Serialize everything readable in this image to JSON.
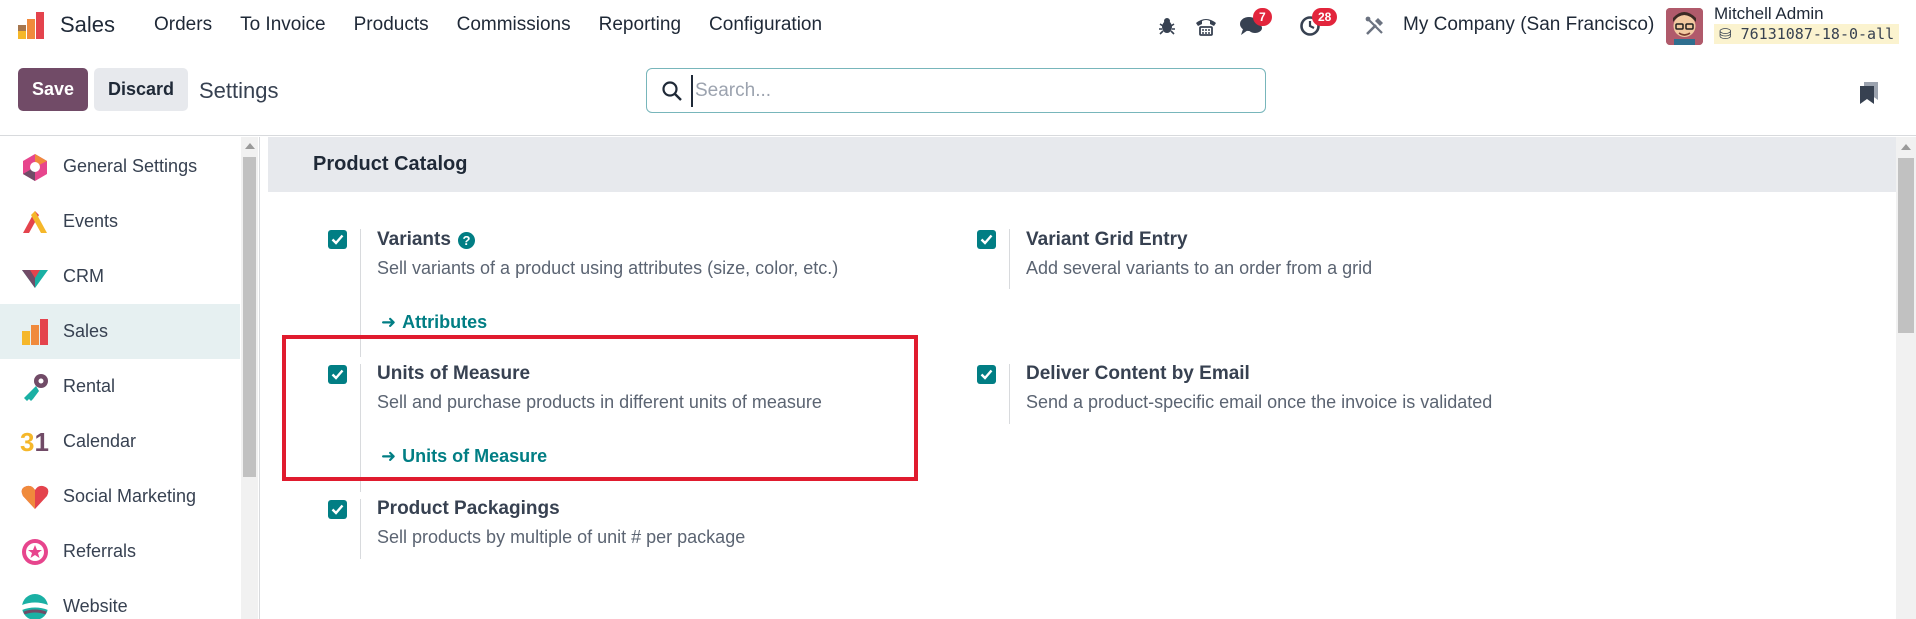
{
  "navbar": {
    "app_name": "Sales",
    "menu": [
      "Orders",
      "To Invoice",
      "Products",
      "Commissions",
      "Reporting",
      "Configuration"
    ],
    "messages_count": "7",
    "activities_count": "28",
    "company": "My Company (San Francisco)",
    "user_name": "Mitchell Admin",
    "db_name": "76131087-18-0-all"
  },
  "controls": {
    "save_label": "Save",
    "discard_label": "Discard",
    "page_title": "Settings",
    "search_placeholder": "Search..."
  },
  "sidebar": {
    "items": [
      {
        "label": "General Settings",
        "icon": "general-settings-icon"
      },
      {
        "label": "Events",
        "icon": "events-icon"
      },
      {
        "label": "CRM",
        "icon": "crm-icon"
      },
      {
        "label": "Sales",
        "icon": "sales-icon",
        "active": true
      },
      {
        "label": "Rental",
        "icon": "rental-icon"
      },
      {
        "label": "Calendar",
        "icon": "calendar-icon",
        "icon_text": "31"
      },
      {
        "label": "Social Marketing",
        "icon": "social-marketing-icon"
      },
      {
        "label": "Referrals",
        "icon": "referrals-icon"
      },
      {
        "label": "Website",
        "icon": "website-icon"
      }
    ]
  },
  "section": {
    "title": "Product Catalog",
    "settings": [
      {
        "title": "Variants",
        "desc": "Sell variants of a product using attributes (size, color, etc.)",
        "link": "Attributes",
        "checked": true,
        "help": true
      },
      {
        "title": "Variant Grid Entry",
        "desc": "Add several variants to an order from a grid",
        "checked": true
      },
      {
        "title": "Units of Measure",
        "desc": "Sell and purchase products in different units of measure",
        "link": "Units of Measure",
        "checked": true
      },
      {
        "title": "Deliver Content by Email",
        "desc": "Send a product-specific email once the invoice is validated",
        "checked": true
      },
      {
        "title": "Product Packagings",
        "desc": "Sell products by multiple of unit # per package",
        "checked": true
      }
    ]
  },
  "colors": {
    "brand": "#714b67",
    "accent": "#017e84",
    "highlight": "#e01b2e",
    "badge": "#e2253c"
  }
}
